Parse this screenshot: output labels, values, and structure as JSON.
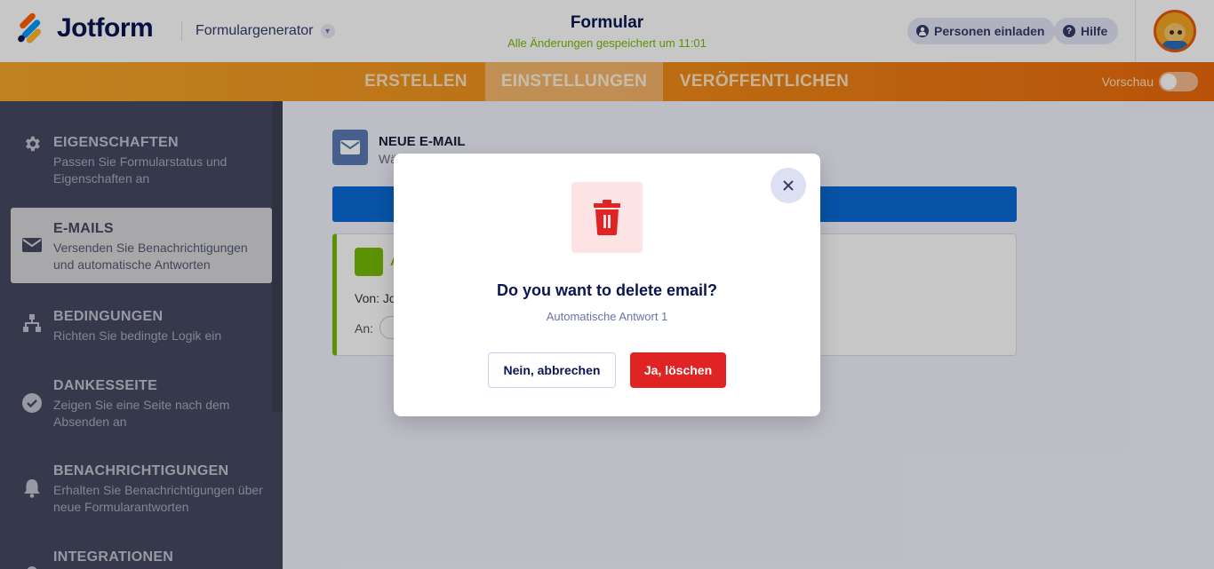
{
  "header": {
    "logo_text": "Jotform",
    "form_generator_label": "Formulargenerator",
    "form_title": "Formular",
    "saved_status": "Alle Änderungen gespeichert um 11:01",
    "invite_label": "Personen einladen",
    "help_label": "Hilfe"
  },
  "tabs": [
    {
      "label": "ERSTELLEN"
    },
    {
      "label": "EINSTELLUNGEN"
    },
    {
      "label": "VERÖFFENTLICHEN"
    }
  ],
  "preview_label": "Vorschau",
  "sidebar": {
    "items": [
      {
        "title": "EIGENSCHAFTEN",
        "desc": "Passen Sie Formularstatus und Eigenschaften an"
      },
      {
        "title": "E-MAILS",
        "desc": "Versenden Sie Benachrichtigungen und automatische Antworten"
      },
      {
        "title": "BEDINGUNGEN",
        "desc": "Richten Sie bedingte Logik ein"
      },
      {
        "title": "DANKESSEITE",
        "desc": "Zeigen Sie eine Seite nach dem Absenden an"
      },
      {
        "title": "BENACHRICHTIGUNGEN",
        "desc": "Erhalten Sie Benachrichtigungen über neue Formularantworten"
      },
      {
        "title": "INTEGRATIONEN",
        "desc": ""
      }
    ]
  },
  "content": {
    "new_email_title": "NEUE E-MAIL",
    "new_email_sub": "Wä",
    "card_title": "A",
    "from_label": "Von: Jo",
    "to_label": "An:"
  },
  "modal": {
    "title": "Do you want to delete email?",
    "subtitle": "Automatische Antwort 1",
    "cancel_label": "Nein, abbrechen",
    "delete_label": "Ja, löschen"
  },
  "colors": {
    "brand_navy": "#0a1551",
    "danger": "#e02323",
    "success": "#78bb07",
    "tab_orange": "#f28f1b"
  }
}
